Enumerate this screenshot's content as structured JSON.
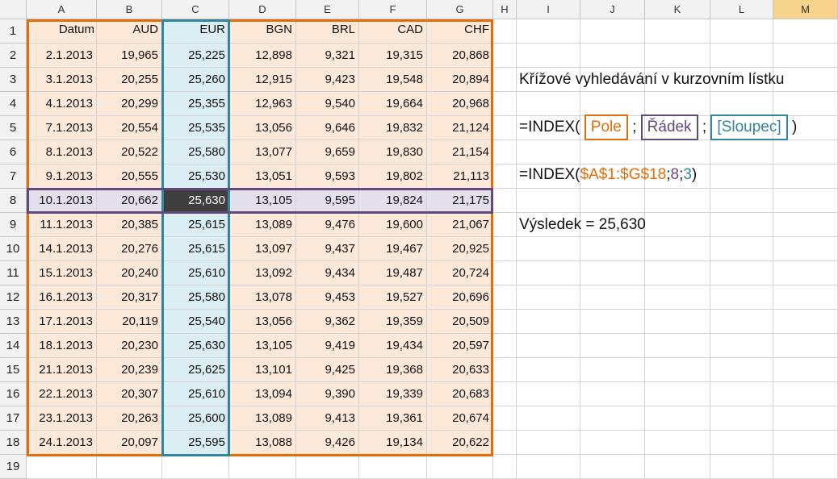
{
  "columns": [
    "A",
    "B",
    "C",
    "D",
    "E",
    "F",
    "G",
    "H",
    "I",
    "J",
    "K",
    "L",
    "M"
  ],
  "selected_column": "M",
  "rows": [
    "1",
    "2",
    "3",
    "4",
    "5",
    "6",
    "7",
    "8",
    "9",
    "10",
    "11",
    "12",
    "13",
    "14",
    "15",
    "16",
    "17",
    "18",
    "19"
  ],
  "table": {
    "headers": [
      "Datum",
      "AUD",
      "EUR",
      "BGN",
      "BRL",
      "CAD",
      "CHF"
    ],
    "data": [
      [
        "2.1.2013",
        "19,965",
        "25,225",
        "12,898",
        "9,321",
        "19,315",
        "20,868"
      ],
      [
        "3.1.2013",
        "20,255",
        "25,260",
        "12,915",
        "9,423",
        "19,548",
        "20,894"
      ],
      [
        "4.1.2013",
        "20,299",
        "25,355",
        "12,963",
        "9,540",
        "19,664",
        "20,968"
      ],
      [
        "7.1.2013",
        "20,554",
        "25,535",
        "13,056",
        "9,646",
        "19,832",
        "21,124"
      ],
      [
        "8.1.2013",
        "20,522",
        "25,580",
        "13,077",
        "9,659",
        "19,830",
        "21,154"
      ],
      [
        "9.1.2013",
        "20,555",
        "25,530",
        "13,051",
        "9,593",
        "19,802",
        "21,113"
      ],
      [
        "10.1.2013",
        "20,662",
        "25,630",
        "13,105",
        "9,595",
        "19,824",
        "21,175"
      ],
      [
        "11.1.2013",
        "20,385",
        "25,615",
        "13,089",
        "9,476",
        "19,600",
        "21,067"
      ],
      [
        "14.1.2013",
        "20,276",
        "25,615",
        "13,097",
        "9,437",
        "19,467",
        "20,925"
      ],
      [
        "15.1.2013",
        "20,240",
        "25,610",
        "13,092",
        "9,434",
        "19,487",
        "20,724"
      ],
      [
        "16.1.2013",
        "20,317",
        "25,580",
        "13,078",
        "9,453",
        "19,527",
        "20,696"
      ],
      [
        "17.1.2013",
        "20,119",
        "25,540",
        "13,056",
        "9,362",
        "19,359",
        "20,509"
      ],
      [
        "18.1.2013",
        "20,230",
        "25,630",
        "13,105",
        "9,419",
        "19,434",
        "20,597"
      ],
      [
        "21.1.2013",
        "20,239",
        "25,625",
        "13,101",
        "9,425",
        "19,368",
        "20,633"
      ],
      [
        "22.1.2013",
        "20,307",
        "25,610",
        "13,094",
        "9,390",
        "19,339",
        "20,683"
      ],
      [
        "23.1.2013",
        "20,263",
        "25,600",
        "13,089",
        "9,413",
        "19,361",
        "20,674"
      ],
      [
        "24.1.2013",
        "20,097",
        "25,595",
        "13,088",
        "9,426",
        "19,134",
        "20,622"
      ]
    ]
  },
  "highlight": {
    "row_index": 7,
    "column_index": 3
  },
  "colors": {
    "orange": "#e46c0a",
    "purple": "#604a7b",
    "teal": "#31859c",
    "result_fill": "#3f3f3f"
  },
  "info": {
    "title": "Křížové vyhledávání v kurzovním lístku",
    "syntax": {
      "prefix": "=INDEX(",
      "pole": "Pole",
      "sep1": ";",
      "radek": "Řádek",
      "sep2": ";",
      "sloupec": "[Sloupec]",
      "suffix": ")"
    },
    "formula": {
      "prefix": "=INDEX(",
      "range": "$A$1:$G$18",
      "sep1": ";",
      "row": "8",
      "sep2": ";",
      "col": "3",
      "suffix": ")"
    },
    "result": "Výsledek = 25,630"
  }
}
